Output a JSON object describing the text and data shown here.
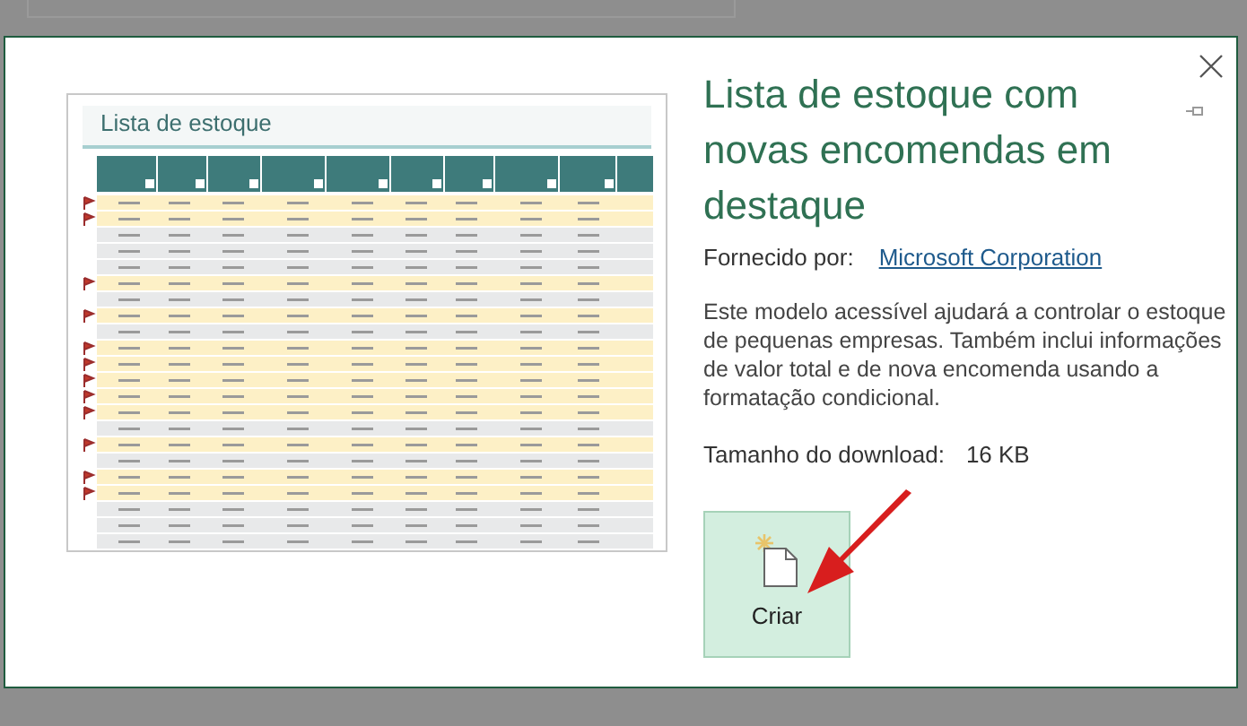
{
  "preview": {
    "title": "Lista de estoque",
    "rows": [
      {
        "flagged": true
      },
      {
        "flagged": true
      },
      {
        "flagged": false
      },
      {
        "flagged": false
      },
      {
        "flagged": false
      },
      {
        "flagged": true
      },
      {
        "flagged": false
      },
      {
        "flagged": true
      },
      {
        "flagged": false
      },
      {
        "flagged": true
      },
      {
        "flagged": true
      },
      {
        "flagged": true
      },
      {
        "flagged": true
      },
      {
        "flagged": true
      },
      {
        "flagged": false
      },
      {
        "flagged": true
      },
      {
        "flagged": false
      },
      {
        "flagged": true
      },
      {
        "flagged": true
      },
      {
        "flagged": false
      },
      {
        "flagged": false
      },
      {
        "flagged": false
      }
    ]
  },
  "template": {
    "title": "Lista de estoque com novas encomendas em destaque",
    "provider_label": "Fornecido por:",
    "provider": "Microsoft Corporation",
    "description": "Este modelo acessível ajudará a controlar o estoque de pequenas empresas. Também inclui informações de valor total e de nova encomenda usando a formatação condicional.",
    "size_label": "Tamanho do download:",
    "size": "16 KB"
  },
  "create_button": "Criar"
}
